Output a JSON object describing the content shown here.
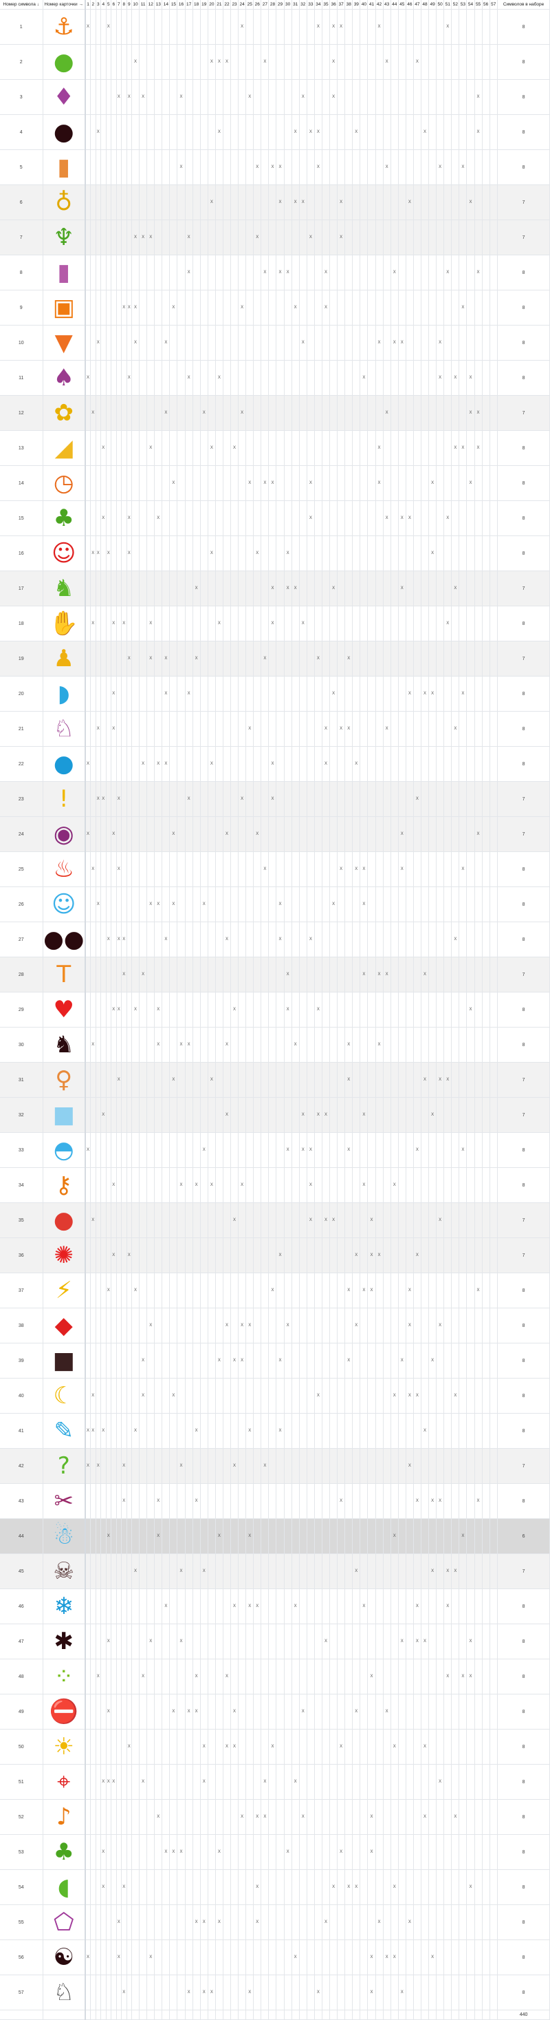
{
  "header": {
    "symbol_col": "Номер символа ↓",
    "card_col": "Номер карточки →",
    "count_col": "Символов в наборе",
    "card_numbers": [
      1,
      2,
      3,
      4,
      5,
      6,
      7,
      8,
      9,
      10,
      11,
      12,
      13,
      14,
      15,
      16,
      17,
      18,
      19,
      20,
      21,
      22,
      23,
      24,
      25,
      26,
      27,
      28,
      29,
      30,
      31,
      32,
      33,
      34,
      35,
      36,
      37,
      38,
      39,
      40,
      41,
      42,
      43,
      44,
      45,
      46,
      47,
      48,
      49,
      50,
      51,
      52,
      53,
      54,
      55,
      56,
      57
    ]
  },
  "mark": "X",
  "total": "440",
  "colors": {
    "row_count7": "#f2f2f2",
    "row_count6": "#d9d9d9",
    "grid": "#e3e6ea"
  },
  "symbols": [
    {
      "n": 1,
      "icon": "anchor-icon",
      "glyph": "⚓",
      "color": "#f07a10",
      "cards": [
        1,
        5,
        24,
        34,
        36,
        37,
        42,
        51
      ],
      "count": 8
    },
    {
      "n": 2,
      "icon": "apple-icon",
      "glyph": "●",
      "color": "#5cb82a",
      "cards": [
        10,
        20,
        21,
        22,
        27,
        36,
        43,
        47
      ],
      "count": 8
    },
    {
      "n": 3,
      "icon": "bird-icon",
      "glyph": "♦",
      "color": "#a0409a",
      "cards": [
        7,
        9,
        11,
        16,
        25,
        32,
        36,
        55
      ],
      "count": 8
    },
    {
      "n": 4,
      "icon": "bomb-icon",
      "glyph": "●",
      "color": "#2a0a0e",
      "cards": [
        3,
        21,
        31,
        33,
        34,
        39,
        48,
        55
      ],
      "count": 8
    },
    {
      "n": 5,
      "icon": "baby-bottle-icon",
      "glyph": "▮",
      "color": "#e88b3a",
      "cards": [
        16,
        26,
        28,
        29,
        34,
        43,
        50,
        53
      ],
      "count": 8
    },
    {
      "n": 6,
      "icon": "lightbulb-icon",
      "glyph": "♁",
      "color": "#e0a800",
      "cards": [
        20,
        29,
        31,
        32,
        37,
        46,
        54
      ],
      "count": 7
    },
    {
      "n": 7,
      "icon": "cactus-icon",
      "glyph": "♆",
      "color": "#4aa520",
      "cards": [
        10,
        11,
        12,
        17,
        26,
        33,
        37
      ],
      "count": 7
    },
    {
      "n": 8,
      "icon": "candle-icon",
      "glyph": "▮",
      "color": "#b45aa8",
      "cards": [
        17,
        27,
        29,
        30,
        35,
        44,
        51,
        55
      ],
      "count": 8
    },
    {
      "n": 9,
      "icon": "taxi-car-icon",
      "glyph": "▣",
      "color": "#f07a10",
      "cards": [
        8,
        9,
        10,
        15,
        24,
        31,
        35,
        53
      ],
      "count": 8
    },
    {
      "n": 10,
      "icon": "carrot-icon",
      "glyph": "▼",
      "color": "#ee7022",
      "cards": [
        3,
        10,
        14,
        32,
        42,
        44,
        45,
        50
      ],
      "count": 8
    },
    {
      "n": 11,
      "icon": "cat-icon",
      "glyph": "♠",
      "color": "#9a3a8e",
      "cards": [
        1,
        9,
        17,
        21,
        40,
        50,
        52,
        54
      ],
      "count": 8
    },
    {
      "n": 12,
      "icon": "daisy-icon",
      "glyph": "✿",
      "color": "#e8b000",
      "cards": [
        2,
        14,
        19,
        24,
        43,
        54,
        55
      ],
      "count": 7
    },
    {
      "n": 13,
      "icon": "cheese-icon",
      "glyph": "◢",
      "color": "#f0b820",
      "cards": [
        4,
        12,
        20,
        23,
        42,
        52,
        53,
        55
      ],
      "count": 8
    },
    {
      "n": 14,
      "icon": "clock-icon",
      "glyph": "◷",
      "color": "#e86a1a",
      "cards": [
        15,
        25,
        27,
        28,
        33,
        42,
        49,
        54
      ],
      "count": 8
    },
    {
      "n": 15,
      "icon": "clover-icon",
      "glyph": "♣",
      "color": "#4aa520",
      "cards": [
        4,
        9,
        13,
        33,
        43,
        45,
        46,
        51
      ],
      "count": 8
    },
    {
      "n": 16,
      "icon": "clown-icon",
      "glyph": "☺",
      "color": "#e02020",
      "cards": [
        2,
        3,
        5,
        9,
        20,
        26,
        30,
        49
      ],
      "count": 8
    },
    {
      "n": 17,
      "icon": "dinosaur-icon",
      "glyph": "♞",
      "color": "#5cb82a",
      "cards": [
        18,
        28,
        30,
        31,
        36,
        45,
        52
      ],
      "count": 7
    },
    {
      "n": 18,
      "icon": "hand-monster-icon",
      "glyph": "✋",
      "color": "#8a3a9a",
      "cards": [
        2,
        6,
        8,
        12,
        21,
        28,
        32,
        51
      ],
      "count": 8
    },
    {
      "n": 19,
      "icon": "dog-icon",
      "glyph": "♟",
      "color": "#eeb010",
      "cards": [
        9,
        12,
        14,
        18,
        27,
        34,
        38
      ],
      "count": 7
    },
    {
      "n": 20,
      "icon": "dolphin-icon",
      "glyph": "◗",
      "color": "#2aa8e0",
      "cards": [
        6,
        14,
        17,
        36,
        46,
        48,
        49,
        53
      ],
      "count": 8
    },
    {
      "n": 21,
      "icon": "dragon-icon",
      "glyph": "♘",
      "color": "#9a3a8e",
      "cards": [
        3,
        6,
        25,
        35,
        37,
        38,
        43,
        52
      ],
      "count": 8
    },
    {
      "n": 22,
      "icon": "water-drop-icon",
      "glyph": "●",
      "color": "#1a9ad8",
      "cards": [
        1,
        11,
        13,
        14,
        20,
        28,
        35,
        39
      ],
      "count": 8
    },
    {
      "n": 23,
      "icon": "exclamation-icon",
      "glyph": "!",
      "color": "#f0b800",
      "cards": [
        3,
        4,
        7,
        17,
        24,
        28,
        47
      ],
      "count": 7
    },
    {
      "n": 24,
      "icon": "eye-icon",
      "glyph": "◉",
      "color": "#8a2a7a",
      "cards": [
        1,
        6,
        15,
        22,
        26,
        45,
        55
      ],
      "count": 7
    },
    {
      "n": 25,
      "icon": "campfire-icon",
      "glyph": "♨",
      "color": "#e8301a",
      "cards": [
        2,
        7,
        27,
        37,
        39,
        40,
        45,
        53
      ],
      "count": 8
    },
    {
      "n": 26,
      "icon": "ghost-icon",
      "glyph": "☺",
      "color": "#3ab0e8",
      "cards": [
        3,
        12,
        13,
        15,
        19,
        29,
        36,
        40
      ],
      "count": 8
    },
    {
      "n": 27,
      "icon": "sunglasses-icon",
      "glyph": "●●",
      "color": "#2a0a0e",
      "cards": [
        5,
        7,
        8,
        14,
        22,
        29,
        33,
        52
      ],
      "count": 8
    },
    {
      "n": 28,
      "icon": "hammer-icon",
      "glyph": "T",
      "color": "#f08a20",
      "cards": [
        8,
        11,
        30,
        40,
        42,
        43,
        48
      ],
      "count": 7
    },
    {
      "n": 29,
      "icon": "heart-icon",
      "glyph": "♥",
      "color": "#e82020",
      "cards": [
        6,
        7,
        10,
        13,
        23,
        30,
        34,
        54
      ],
      "count": 8
    },
    {
      "n": 30,
      "icon": "chess-knight-icon",
      "glyph": "♞",
      "color": "#2a0a0e",
      "cards": [
        2,
        13,
        16,
        17,
        22,
        31,
        38,
        42
      ],
      "count": 8
    },
    {
      "n": 31,
      "icon": "gingerbread-man-icon",
      "glyph": "♀",
      "color": "#e88a3a",
      "cards": [
        7,
        15,
        20,
        38,
        48,
        50,
        51
      ],
      "count": 7
    },
    {
      "n": 32,
      "icon": "ice-cube-icon",
      "glyph": "■",
      "color": "#8ed0f0",
      "cards": [
        4,
        22,
        32,
        34,
        35,
        40,
        49
      ],
      "count": 7
    },
    {
      "n": 33,
      "icon": "igloo-icon",
      "glyph": "◓",
      "color": "#3ab0e8",
      "cards": [
        1,
        19,
        30,
        32,
        33,
        38,
        47,
        53
      ],
      "count": 8
    },
    {
      "n": 34,
      "icon": "key-icon",
      "glyph": "⚷",
      "color": "#ea7a10",
      "cards": [
        6,
        16,
        18,
        20,
        24,
        33,
        40,
        44
      ],
      "count": 8
    },
    {
      "n": 35,
      "icon": "ladybug-icon",
      "glyph": "●",
      "color": "#e03a30",
      "cards": [
        2,
        23,
        33,
        35,
        36,
        41,
        50
      ],
      "count": 7
    },
    {
      "n": 36,
      "icon": "maple-leaf-icon",
      "glyph": "✺",
      "color": "#e82020",
      "cards": [
        6,
        9,
        29,
        39,
        41,
        42,
        47
      ],
      "count": 7
    },
    {
      "n": 37,
      "icon": "lightning-icon",
      "glyph": "⚡",
      "color": "#f0b800",
      "cards": [
        5,
        10,
        28,
        38,
        40,
        41,
        46,
        55
      ],
      "count": 8
    },
    {
      "n": 38,
      "icon": "lips-icon",
      "glyph": "◆",
      "color": "#e02020",
      "cards": [
        12,
        22,
        24,
        25,
        30,
        39,
        46,
        50
      ],
      "count": 8
    },
    {
      "n": 39,
      "icon": "padlock-icon",
      "glyph": "■",
      "color": "#3a2020",
      "cards": [
        11,
        21,
        23,
        24,
        29,
        38,
        45,
        49
      ],
      "count": 8
    },
    {
      "n": 40,
      "icon": "moon-icon",
      "glyph": "☾",
      "color": "#f0b800",
      "cards": [
        2,
        11,
        15,
        34,
        44,
        46,
        47,
        52
      ],
      "count": 8
    },
    {
      "n": 41,
      "icon": "pencil-icon",
      "glyph": "✎",
      "color": "#2aa8e0",
      "cards": [
        1,
        2,
        4,
        10,
        18,
        25,
        29,
        48
      ],
      "count": 8
    },
    {
      "n": 42,
      "icon": "question-mark-icon",
      "glyph": "?",
      "color": "#5cb82a",
      "cards": [
        1,
        3,
        8,
        16,
        23,
        27,
        46
      ],
      "count": 7
    },
    {
      "n": 43,
      "icon": "scissors-icon",
      "glyph": "✂",
      "color": "#9a2a6a",
      "cards": [
        8,
        13,
        18,
        37,
        47,
        49,
        50,
        55
      ],
      "count": 8
    },
    {
      "n": 44,
      "icon": "snowman-icon",
      "glyph": "☃",
      "color": "#3ab0e8",
      "cards": [
        5,
        13,
        21,
        25,
        44,
        53
      ],
      "count": 6
    },
    {
      "n": 45,
      "icon": "skull-crossbones-icon",
      "glyph": "☠",
      "color": "#5a3a3a",
      "cards": [
        10,
        16,
        19,
        39,
        49,
        51,
        52
      ],
      "count": 7
    },
    {
      "n": 46,
      "icon": "snowflake-icon",
      "glyph": "❄",
      "color": "#1a9ad8",
      "cards": [
        14,
        23,
        25,
        26,
        31,
        40,
        47,
        51
      ],
      "count": 8
    },
    {
      "n": 47,
      "icon": "spider-icon",
      "glyph": "✱",
      "color": "#2a0a0e",
      "cards": [
        5,
        12,
        16,
        35,
        45,
        47,
        48,
        54
      ],
      "count": 8
    },
    {
      "n": 48,
      "icon": "splash-icon",
      "glyph": "⁘",
      "color": "#7ac020",
      "cards": [
        3,
        11,
        18,
        22,
        41,
        51,
        53,
        54
      ],
      "count": 8
    },
    {
      "n": 49,
      "icon": "no-entry-icon",
      "glyph": "⛔",
      "color": "#e02020",
      "cards": [
        5,
        15,
        17,
        18,
        23,
        32,
        39,
        43
      ],
      "count": 8
    },
    {
      "n": 50,
      "icon": "sun-icon",
      "glyph": "☀",
      "color": "#f0b800",
      "cards": [
        9,
        19,
        22,
        23,
        28,
        37,
        44,
        48
      ],
      "count": 8
    },
    {
      "n": 51,
      "icon": "target-icon",
      "glyph": "⌖",
      "color": "#e02020",
      "cards": [
        4,
        5,
        6,
        11,
        19,
        27,
        31,
        50
      ],
      "count": 8
    },
    {
      "n": 52,
      "icon": "treble-clef-icon",
      "glyph": "♪",
      "color": "#ea7a10",
      "cards": [
        13,
        24,
        26,
        27,
        32,
        41,
        48,
        52
      ],
      "count": 8
    },
    {
      "n": 53,
      "icon": "tree-icon",
      "glyph": "♣",
      "color": "#4aa520",
      "cards": [
        4,
        14,
        15,
        16,
        21,
        30,
        37,
        41
      ],
      "count": 8
    },
    {
      "n": 54,
      "icon": "turtle-icon",
      "glyph": "◖",
      "color": "#5cb82a",
      "cards": [
        4,
        8,
        26,
        36,
        38,
        39,
        44,
        54
      ],
      "count": 8
    },
    {
      "n": 55,
      "icon": "spider-web-icon",
      "glyph": "⬠",
      "color": "#a03a9a",
      "cards": [
        7,
        18,
        19,
        21,
        26,
        35,
        42,
        46
      ],
      "count": 8
    },
    {
      "n": 56,
      "icon": "yin-yang-icon",
      "glyph": "☯",
      "color": "#2a0a0e",
      "cards": [
        1,
        7,
        12,
        31,
        41,
        43,
        44,
        49
      ],
      "count": 8
    },
    {
      "n": 57,
      "icon": "zebra-icon",
      "glyph": "♘",
      "color": "#333333",
      "cards": [
        8,
        17,
        19,
        20,
        25,
        34,
        41,
        45
      ],
      "count": 8
    }
  ]
}
